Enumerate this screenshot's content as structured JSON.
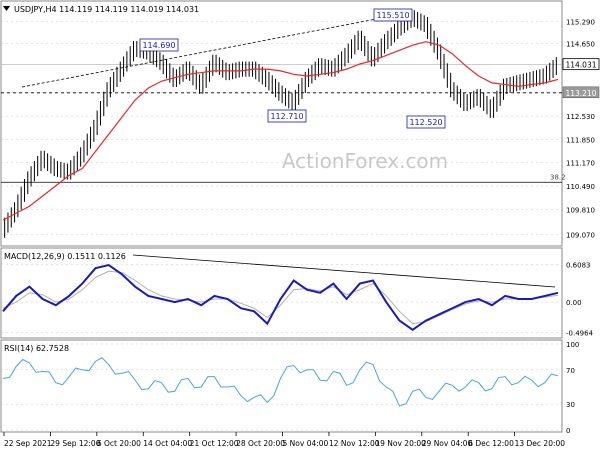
{
  "window": {
    "symbol_header": "USDJPY,H4  114.119 114.119 114.019 114.031",
    "watermark": "ActionForex.com"
  },
  "colors": {
    "price_bars": "#000000",
    "moving_average": "#e8262b",
    "macd_line": "#1a1ab8",
    "macd_signal": "#b0b0b0",
    "rsi_line": "#4aa3df",
    "grid": "#c8c8c8",
    "trendline": "#000000"
  },
  "chart_data": [
    {
      "type": "line",
      "panel": "price",
      "title": "USDJPY,H4  114.119 114.119 114.019 114.031",
      "ylim": [
        108.8,
        115.8
      ],
      "yticks": [
        "115.290",
        "114.650",
        "113.210",
        "112.530",
        "111.850",
        "111.170",
        "110.490",
        "109.810",
        "109.070"
      ],
      "ytick_values": [
        115.29,
        114.65,
        113.21,
        112.53,
        111.85,
        111.17,
        110.49,
        109.81,
        109.07
      ],
      "current_price_label": "114.031",
      "current_price": 114.031,
      "support_label": "113.210",
      "support": 113.21,
      "fib_label": "38.2",
      "fib_level": 110.6,
      "annotations": [
        {
          "text": "114.690",
          "value": 114.69
        },
        {
          "text": "115.510",
          "value": 115.51
        },
        {
          "text": "112.710",
          "value": 112.71
        },
        {
          "text": "112.520",
          "value": 112.52
        }
      ],
      "x": [
        0,
        3,
        6,
        9,
        12,
        15,
        18,
        21,
        24,
        27,
        30,
        33,
        36,
        39,
        42,
        45,
        48,
        51,
        54,
        57,
        60,
        63,
        66,
        69,
        72,
        75,
        78,
        81,
        84,
        87,
        90,
        93,
        96,
        99,
        102,
        105,
        108,
        111,
        114,
        117,
        120,
        123,
        126
      ],
      "close": [
        109.2,
        109.8,
        110.7,
        111.3,
        111.0,
        110.9,
        111.4,
        112.2,
        113.3,
        113.9,
        114.5,
        114.4,
        114.1,
        113.6,
        113.9,
        113.4,
        114.1,
        113.8,
        113.9,
        113.9,
        113.6,
        113.2,
        112.9,
        113.6,
        114.0,
        113.9,
        114.3,
        114.8,
        114.2,
        114.7,
        115.1,
        115.4,
        115.2,
        114.4,
        113.3,
        112.9,
        113.1,
        112.7,
        113.4,
        113.5,
        113.6,
        113.7,
        114.03
      ],
      "ma": [
        109.5,
        109.7,
        109.9,
        110.2,
        110.5,
        110.8,
        111.0,
        111.5,
        112.0,
        112.5,
        113.0,
        113.35,
        113.55,
        113.65,
        113.75,
        113.8,
        113.85,
        113.85,
        113.85,
        113.9,
        113.9,
        113.85,
        113.75,
        113.7,
        113.75,
        113.8,
        113.9,
        114.05,
        114.15,
        114.3,
        114.45,
        114.6,
        114.7,
        114.6,
        114.35,
        114.0,
        113.7,
        113.5,
        113.45,
        113.4,
        113.45,
        113.5,
        113.6
      ]
    },
    {
      "type": "line",
      "panel": "macd",
      "title": "MACD(12,26,9) 0.1511 0.1126",
      "ylim": [
        -0.55,
        0.65
      ],
      "yticks": [
        "0.6083",
        "0.00",
        "-0.4964"
      ],
      "ytick_values": [
        0.6083,
        0.0,
        -0.4964
      ],
      "x": [
        0,
        3,
        6,
        9,
        12,
        15,
        18,
        21,
        24,
        27,
        30,
        33,
        36,
        39,
        42,
        45,
        48,
        51,
        54,
        57,
        60,
        63,
        66,
        69,
        72,
        75,
        78,
        81,
        84,
        87,
        90,
        93,
        96,
        99,
        102,
        105,
        108,
        111,
        114,
        117,
        120,
        123,
        126
      ],
      "macd": [
        -0.15,
        0.1,
        0.25,
        0.05,
        -0.05,
        0.1,
        0.3,
        0.55,
        0.6,
        0.45,
        0.25,
        0.1,
        0.05,
        0.0,
        0.05,
        -0.05,
        0.1,
        0.05,
        -0.1,
        -0.15,
        -0.35,
        0.05,
        0.35,
        0.2,
        0.15,
        0.3,
        0.05,
        0.3,
        0.35,
        0.0,
        -0.3,
        -0.45,
        -0.3,
        -0.2,
        -0.1,
        0.0,
        0.05,
        -0.05,
        0.1,
        0.05,
        0.05,
        0.1,
        0.15
      ],
      "signal": [
        -0.1,
        0.0,
        0.15,
        0.12,
        0.0,
        0.05,
        0.2,
        0.4,
        0.5,
        0.48,
        0.35,
        0.2,
        0.1,
        0.05,
        0.03,
        0.0,
        0.05,
        0.05,
        -0.02,
        -0.1,
        -0.25,
        -0.05,
        0.2,
        0.22,
        0.18,
        0.25,
        0.12,
        0.2,
        0.3,
        0.1,
        -0.15,
        -0.35,
        -0.32,
        -0.22,
        -0.12,
        -0.03,
        0.02,
        0.0,
        0.05,
        0.05,
        0.05,
        0.08,
        0.11
      ]
    },
    {
      "type": "line",
      "panel": "rsi",
      "title": "RSI(14) 62.7528",
      "ylim": [
        0,
        100
      ],
      "yticks": [
        "100",
        "70",
        "30",
        "0"
      ],
      "ytick_values": [
        100,
        70,
        30,
        0
      ],
      "x": [
        0,
        3,
        6,
        9,
        12,
        15,
        18,
        21,
        24,
        27,
        30,
        33,
        36,
        39,
        42,
        45,
        48,
        51,
        54,
        57,
        60,
        63,
        66,
        69,
        72,
        75,
        78,
        81,
        84,
        87,
        90,
        93,
        96,
        99,
        102,
        105,
        108,
        111,
        114,
        117,
        120,
        123,
        126
      ],
      "values": [
        60,
        74,
        78,
        68,
        55,
        62,
        70,
        80,
        76,
        66,
        58,
        48,
        55,
        45,
        60,
        50,
        62,
        50,
        40,
        38,
        32,
        60,
        75,
        70,
        58,
        68,
        52,
        70,
        76,
        50,
        28,
        45,
        38,
        45,
        52,
        50,
        55,
        48,
        62,
        55,
        58,
        55,
        63
      ]
    }
  ],
  "time_axis": {
    "labels": [
      "22 Sep 2021",
      "29 Sep 12:00",
      "6 Oct 20:00",
      "14 Oct 04:00",
      "21 Oct 12:00",
      "28 Oct 20:00",
      "5 Nov 04:00",
      "12 Nov 12:00",
      "19 Nov 20:00",
      "29 Nov 04:00",
      "6 Dec 12:00",
      "13 Dec 20:00"
    ],
    "positions": [
      0,
      11,
      22,
      33,
      44,
      55,
      66,
      77,
      88,
      99,
      110,
      121
    ]
  }
}
